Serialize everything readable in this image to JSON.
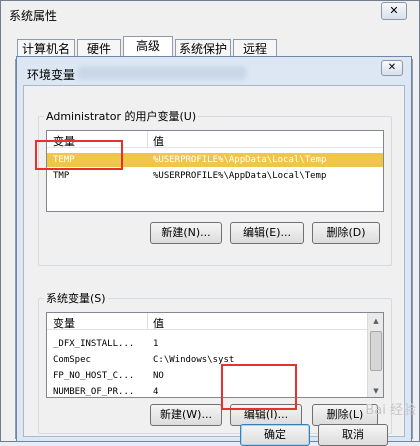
{
  "outer_window": {
    "title": "系统属性",
    "close_button": "✕",
    "tabs": [
      "计算机名",
      "硬件",
      "高级",
      "系统保护",
      "远程"
    ]
  },
  "env_dialog": {
    "title": "环境变量",
    "close_button": "✕",
    "user_vars": {
      "group_label": "Administrator 的用户变量(U)",
      "columns": [
        "变量",
        "值"
      ],
      "rows": [
        {
          "name": "TEMP",
          "value": "%USERPROFILE%\\AppData\\Local\\Temp"
        },
        {
          "name": "TMP",
          "value": "%USERPROFILE%\\AppData\\Local\\Temp"
        }
      ],
      "new_button": "新建(N)...",
      "edit_button": "编辑(E)...",
      "delete_button": "删除(D)"
    },
    "system_vars": {
      "group_label": "系统变量(S)",
      "columns": [
        "变量",
        "值"
      ],
      "rows": [
        {
          "name": "_DFX_INSTALL...",
          "value": "1"
        },
        {
          "name": "ComSpec",
          "value": "C:\\Windows\\syst"
        },
        {
          "name": "FP_NO_HOST_C...",
          "value": "NO"
        },
        {
          "name": "NUMBER_OF_PR...",
          "value": "4"
        }
      ],
      "new_button": "新建(W)...",
      "edit_button": "编辑(I)...",
      "delete_button": "删除(L)"
    },
    "ok_button": "确定",
    "cancel_button": "取消"
  },
  "watermark": "Bai 经验",
  "colors": {
    "selection": "#f0c64a",
    "highlight_box": "#e8302e"
  }
}
